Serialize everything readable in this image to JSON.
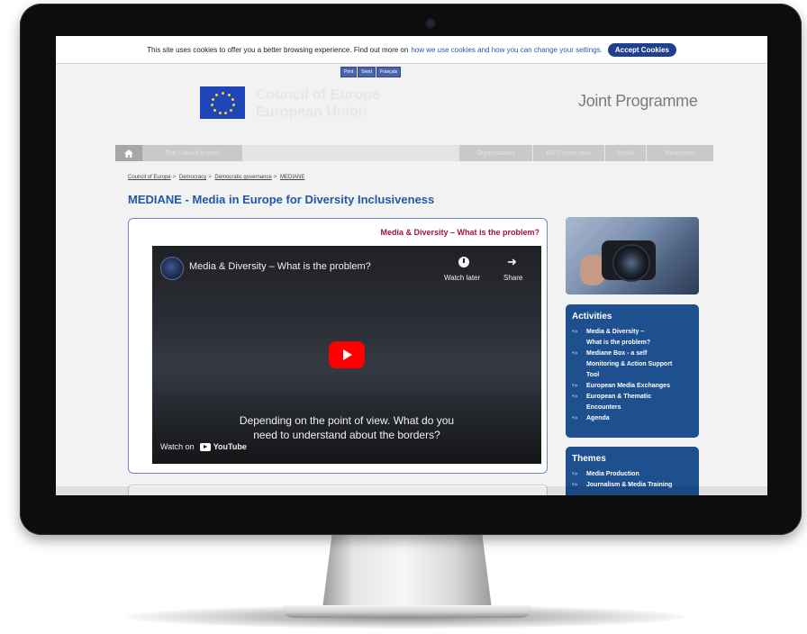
{
  "cookie_bar": {
    "message": "This site uses cookies to offer you a better browsing experience. Find out more on",
    "link": "how we use cookies and how you can change your settings.",
    "accept": "Accept Cookies"
  },
  "mini_buttons": [
    "Print",
    "Send",
    "Français"
  ],
  "brand": {
    "line1": "Council of Europe",
    "line2": "European Union",
    "right_title": "Joint Programme"
  },
  "nav": {
    "items": [
      {
        "label": "The Council in brief",
        "style": "dark"
      },
      {
        "label": "",
        "style": "light"
      },
      {
        "label": "",
        "style": "light"
      },
      {
        "label": "",
        "style": "light"
      },
      {
        "label": "Organisations",
        "style": "dark"
      },
      {
        "label": "EU Cooperation",
        "style": "dark"
      },
      {
        "label": "Portal",
        "style": "dark"
      },
      {
        "label": "Newsletter",
        "style": "dark"
      }
    ]
  },
  "breadcrumb": [
    "Council of Europe",
    "Democracy",
    "Democratic governance",
    "MEDIANE"
  ],
  "page_title": "MEDIANE - Media in Europe for Diversity Inclusiveness",
  "video": {
    "heading": "Media & Diversity – What is the problem?",
    "title": "Media & Diversity – What is the problem?",
    "watch_later": "Watch later",
    "share": "Share",
    "subtitle": "Depending on the point of view. What do you\nneed to understand about the borders?",
    "watch_on": "Watch on",
    "youtube": "YouTube"
  },
  "activities": {
    "title": "Activities",
    "items": [
      "Media & Diversity –",
      "What is the problem?",
      "Mediane Box - a self",
      "Monitoring & Action Support",
      "Tool",
      "European Media Exchanges",
      "European & Thematic",
      "Encounters",
      "Agenda"
    ],
    "bullets": [
      true,
      false,
      true,
      false,
      false,
      true,
      true,
      false,
      true
    ]
  },
  "themes": {
    "title": "Themes",
    "items": [
      "Media Production",
      "Journalism & Media Training"
    ]
  },
  "colors": {
    "accent": "#1e5aa8",
    "panel": "#1e4f8f",
    "heading": "#a0123f",
    "yt_red": "#ff0000"
  }
}
